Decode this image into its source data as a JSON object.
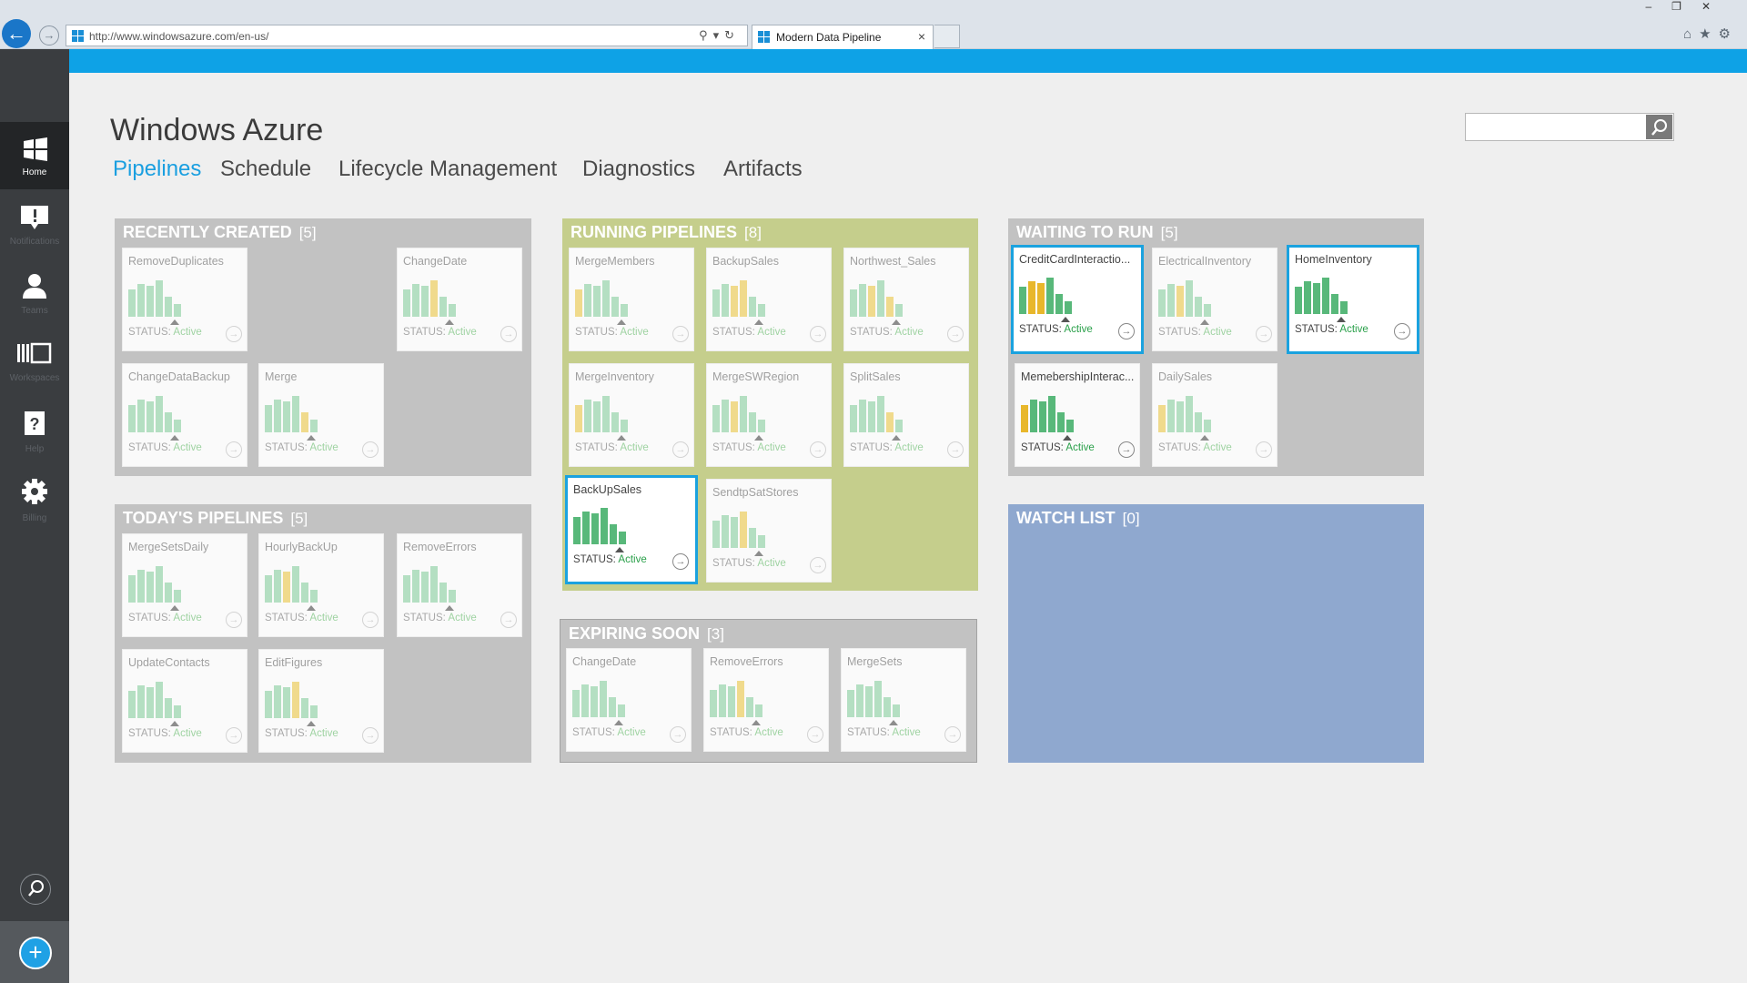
{
  "browser": {
    "url": "http://www.windowsazure.com/en-us/",
    "tab_title": "Modern Data Pipeline"
  },
  "app": {
    "title": "Windows Azure",
    "tabs": [
      {
        "label": "Pipelines",
        "active": true
      },
      {
        "label": "Schedule",
        "active": false
      },
      {
        "label": "Lifecycle Management",
        "active": false
      },
      {
        "label": "Diagnostics",
        "active": false
      },
      {
        "label": "Artifacts",
        "active": false
      }
    ],
    "search_placeholder": ""
  },
  "leftnav": {
    "items": [
      {
        "label": "Home",
        "icon": "windows-logo-icon"
      },
      {
        "label": "Notifications",
        "icon": "notification-icon"
      },
      {
        "label": "Teams",
        "icon": "person-icon"
      },
      {
        "label": "Workspaces",
        "icon": "workspaces-icon"
      },
      {
        "label": "Help",
        "icon": "help-icon"
      },
      {
        "label": "Billing",
        "icon": "gear-icon"
      }
    ]
  },
  "colors": {
    "accent": "#1aa2df",
    "bar_green": "#58b87a",
    "bar_yellow": "#e8b72b",
    "running_group": "#c5ce8c",
    "watch_group": "#8fa8cf"
  },
  "status_label": "STATUS:",
  "groups": {
    "recent": {
      "title": "RECENTLY CREATED",
      "count": "[5]",
      "tiles": [
        {
          "name": "RemoveDuplicates",
          "status": "Active",
          "bars": "gggggg"
        },
        {
          "name": "ChangeDate",
          "status": "Active",
          "bars": "gggygg"
        },
        {
          "name": "ChangeDataBackup",
          "status": "Active",
          "bars": "gggggg"
        },
        {
          "name": "Merge",
          "status": "Active",
          "bars": "ggggyg"
        }
      ]
    },
    "running": {
      "title": "RUNNING PIPELINES",
      "count": "[8]",
      "tiles": [
        {
          "name": "MergeMembers",
          "status": "Active",
          "bars": "yggggg"
        },
        {
          "name": "BackupSales",
          "status": "Active",
          "bars": "ggyygg"
        },
        {
          "name": "Northwest_Sales",
          "status": "Active",
          "bars": "ggygyg"
        },
        {
          "name": "MergeInventory",
          "status": "Active",
          "bars": "yggggg"
        },
        {
          "name": "MergeSWRegion",
          "status": "Active",
          "bars": "ggyggg"
        },
        {
          "name": "SplitSales",
          "status": "Active",
          "bars": "ggggyg"
        },
        {
          "name": "BackUpSales",
          "status": "Active",
          "bars": "gggggg"
        },
        {
          "name": "SendtpSatStores",
          "status": "Active",
          "bars": "gggygg"
        }
      ]
    },
    "waiting": {
      "title": "WAITING TO RUN",
      "count": "[5]",
      "tiles": [
        {
          "name": "CreditCardInteractio...",
          "status": "Active",
          "bars": "gyyggg"
        },
        {
          "name": "ElectricalInventory",
          "status": "Active",
          "bars": "ggyggg"
        },
        {
          "name": "HomeInventory",
          "status": "Active",
          "bars": "gggggg"
        },
        {
          "name": "MemebershipInterac...",
          "status": "Active",
          "bars": "yggggg"
        },
        {
          "name": "DailySales",
          "status": "Active",
          "bars": "yggggg"
        }
      ]
    },
    "today": {
      "title": "TODAY'S PIPELINES",
      "count": "[5]",
      "tiles": [
        {
          "name": "MergeSetsDaily",
          "status": "Active",
          "bars": "gggggg"
        },
        {
          "name": "HourlyBackUp",
          "status": "Active",
          "bars": "ggyggg"
        },
        {
          "name": "RemoveErrors",
          "status": "Active",
          "bars": "gggggg"
        },
        {
          "name": "UpdateContacts",
          "status": "Active",
          "bars": "gggggg"
        },
        {
          "name": "EditFigures",
          "status": "Active",
          "bars": "gggygg"
        }
      ]
    },
    "expiring": {
      "title": "EXPIRING SOON",
      "count": "[3]",
      "tiles": [
        {
          "name": "ChangeDate",
          "status": "Active",
          "bars": "gggggg"
        },
        {
          "name": "RemoveErrors",
          "status": "Active",
          "bars": "gggygg"
        },
        {
          "name": "MergeSets",
          "status": "Active",
          "bars": "gggggg"
        }
      ]
    },
    "watch": {
      "title": "WATCH LIST",
      "count": "[0]"
    }
  }
}
